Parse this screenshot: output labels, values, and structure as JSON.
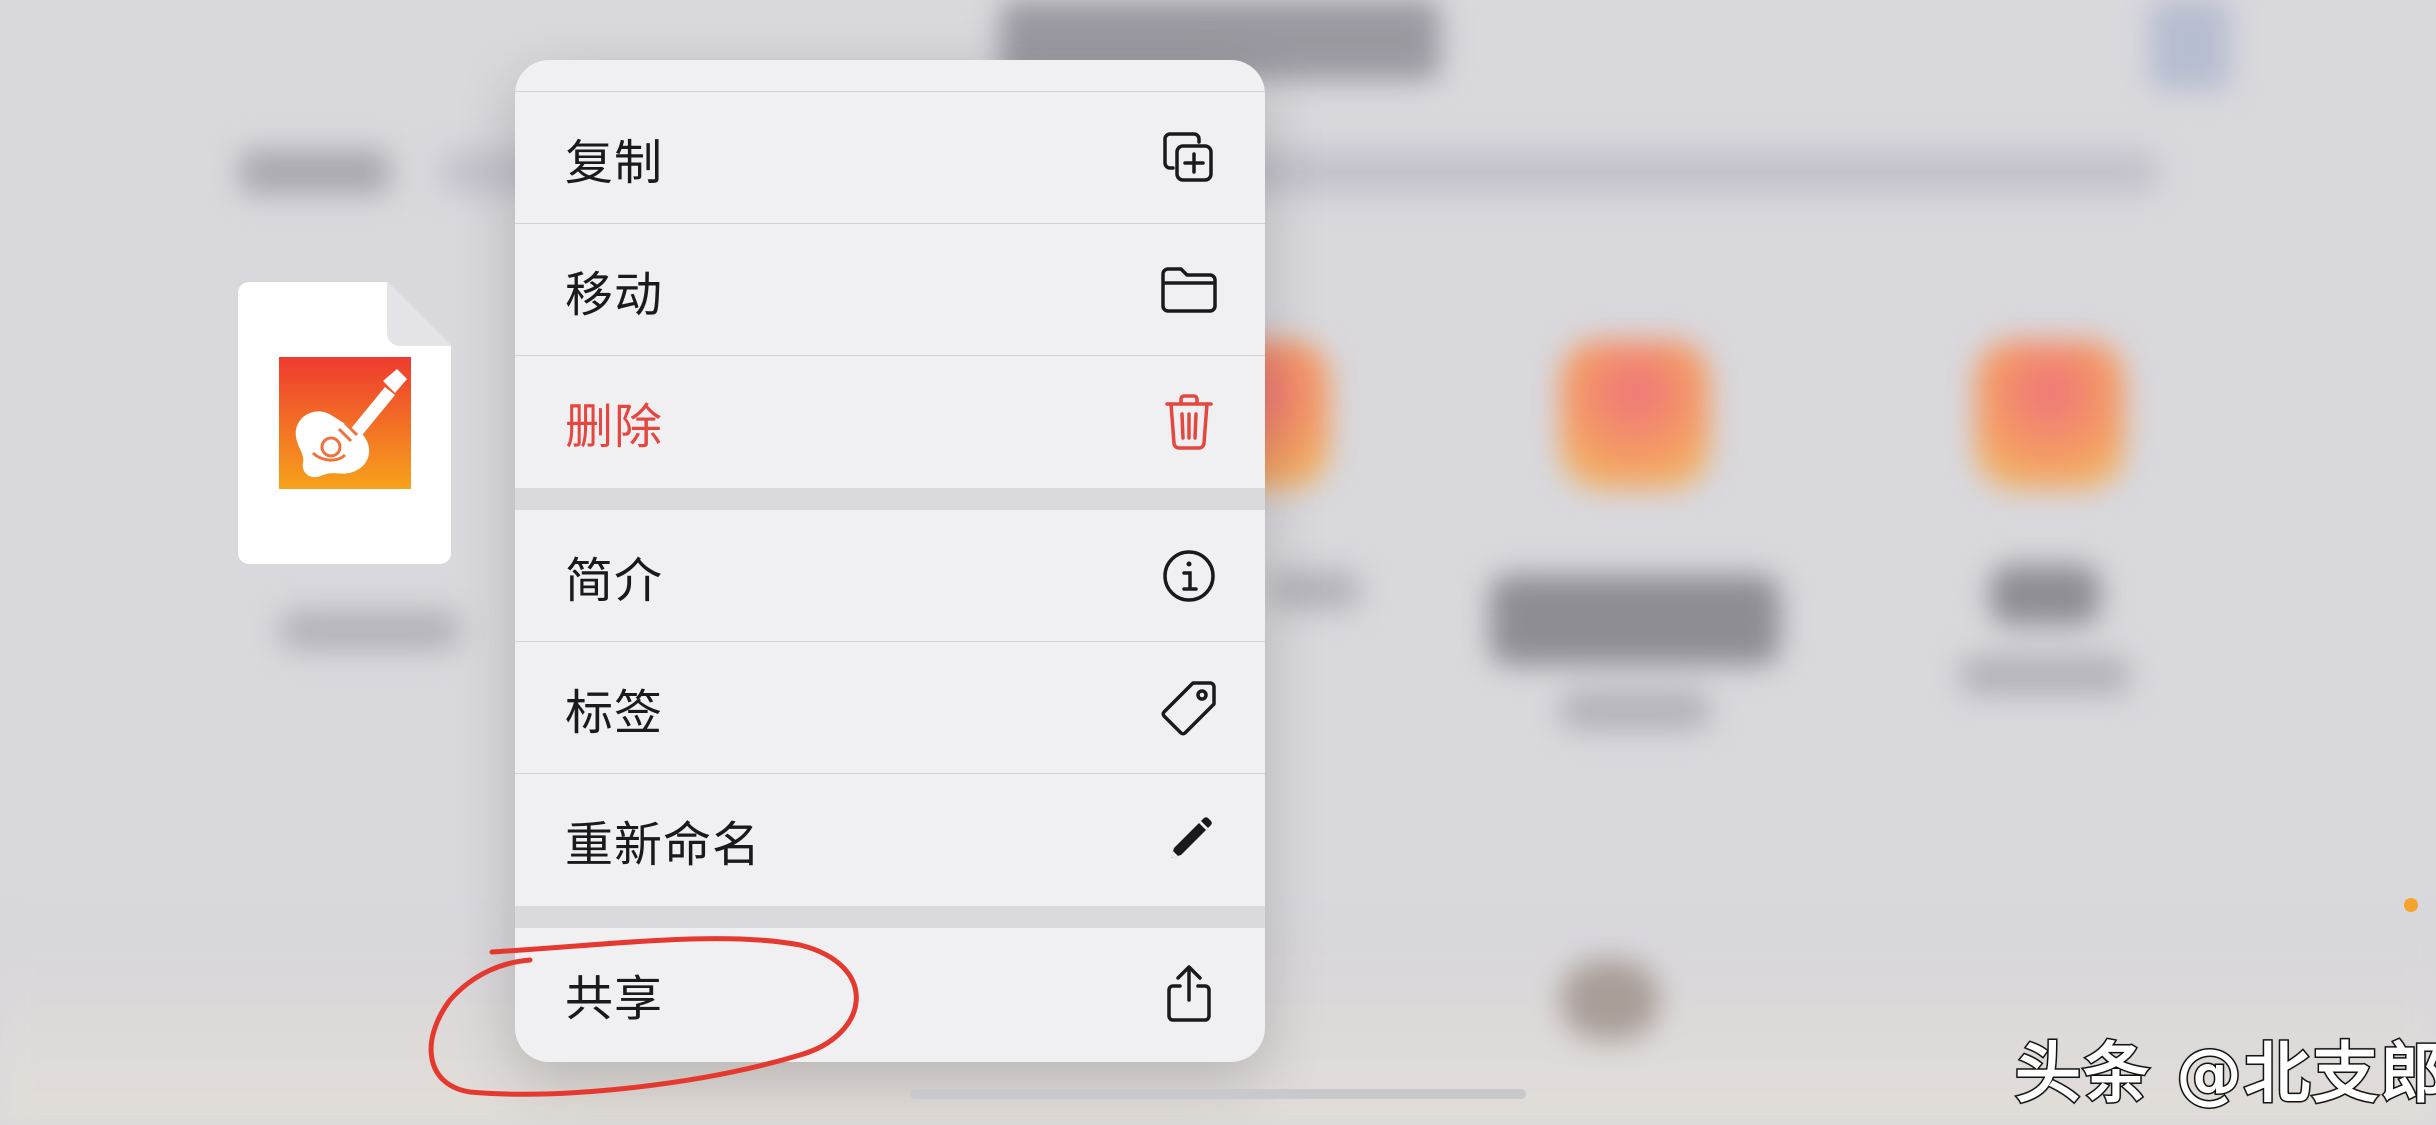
{
  "menu": {
    "items": [
      {
        "label": "复制",
        "icon": "duplicate-icon"
      },
      {
        "label": "移动",
        "icon": "folder-icon"
      },
      {
        "label": "删除",
        "icon": "trash-icon",
        "destructive": true
      },
      {
        "label": "简介",
        "icon": "info-icon"
      },
      {
        "label": "标签",
        "icon": "tag-icon"
      },
      {
        "label": "重新命名",
        "icon": "pencil-icon"
      },
      {
        "label": "共享",
        "icon": "share-icon"
      }
    ]
  },
  "file_preview": {
    "icon": "garageband-guitar-icon"
  },
  "annotation": {
    "highlight_target": "共享",
    "color": "#e5392f"
  },
  "watermark": {
    "text": "头条 @北支郎"
  },
  "colors": {
    "menu_background": "#f0f0f3",
    "destructive": "#e5473f",
    "label": "#1a1a1c",
    "status_dot": "#f5a32a"
  }
}
